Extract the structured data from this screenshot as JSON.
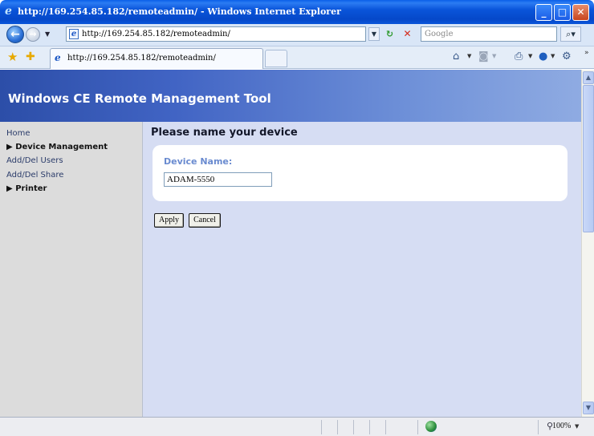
{
  "window": {
    "title": "http://169.254.85.182/remoteadmin/ - Windows Internet Explorer",
    "min_glyph": "_",
    "max_glyph": "□",
    "close_glyph": "✕"
  },
  "address_bar": {
    "url": "http://169.254.85.182/remoteadmin/",
    "search_placeholder": "Google"
  },
  "tab": {
    "label": "http://169.254.85.182/remoteadmin/"
  },
  "page": {
    "banner_title": "Windows CE Remote Management Tool",
    "sidebar": {
      "home": "Home",
      "device_management": "Device Management",
      "add_del_users": "Add/Del Users",
      "add_del_share": "Add/Del Share",
      "printer": "Printer"
    },
    "heading": "Please name your device",
    "form": {
      "device_name_label": "Device Name:",
      "device_name_value": "ADAM-5550",
      "apply_label": "Apply",
      "cancel_label": "Cancel"
    }
  },
  "status_bar": {
    "zoom": "100%"
  },
  "icons": {
    "back": "back-arrow-icon",
    "forward": "forward-arrow-icon",
    "refresh": "refresh-icon",
    "stop": "stop-icon",
    "search": "search-icon",
    "favorites": "favorites-star-icon",
    "add_favorites": "add-favorites-icon",
    "home": "home-icon",
    "feeds": "feeds-icon",
    "print": "print-icon",
    "help": "help-icon",
    "tools": "tools-icon"
  },
  "colors": {
    "titlebar": "#0a55da",
    "banner_start": "#2c4ea8",
    "banner_end": "#8fabe2",
    "content_bg": "#d6ddf3",
    "sidebar_bg": "#dcdcdc",
    "field_label": "#6a8bd0"
  }
}
